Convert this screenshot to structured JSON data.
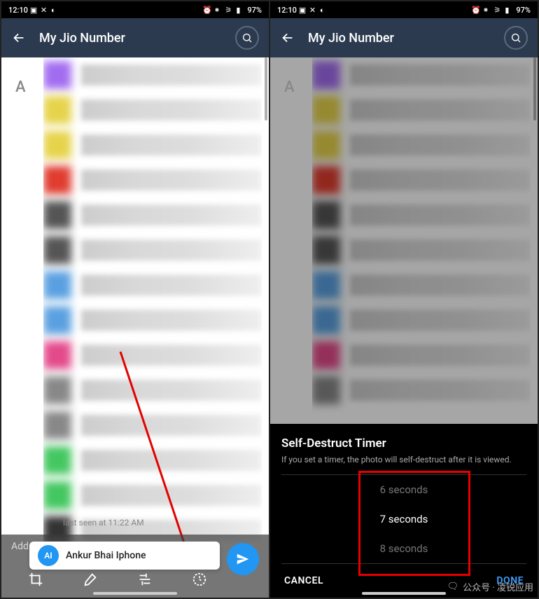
{
  "status": {
    "time": "12:10",
    "battery": "97%"
  },
  "left": {
    "title": "My Jio Number",
    "letter": "A",
    "caption_placeholder": "Add a caption...",
    "reply": {
      "initials": "AI",
      "name": "Ankur Bhai Iphone"
    },
    "last_seen": "last seen at 11:22 AM",
    "avatars": [
      "#a26cf0",
      "#e6d34a",
      "#e6d34a",
      "#e03c2f",
      "#555",
      "#555",
      "#5aa0e0",
      "#5aa0e0",
      "#e34a8a",
      "#888",
      "#888",
      "#44c760",
      "#44c760",
      "#333"
    ]
  },
  "right": {
    "title": "My Jio Number",
    "letter": "A",
    "sheet_title": "Self-Destruct Timer",
    "sheet_desc": "If you set a timer, the photo will self-destruct after it is viewed.",
    "options": [
      "6 seconds",
      "7 seconds",
      "8 seconds"
    ],
    "selected": 1,
    "cancel": "CANCEL",
    "done": "DONE",
    "avatars": [
      "#a26cf0",
      "#e6d34a",
      "#e6d34a",
      "#e03c2f",
      "#555",
      "#555",
      "#5aa0e0",
      "#5aa0e0",
      "#e34a8a",
      "#888"
    ]
  },
  "watermark": "公众号 · 凌锐应用"
}
